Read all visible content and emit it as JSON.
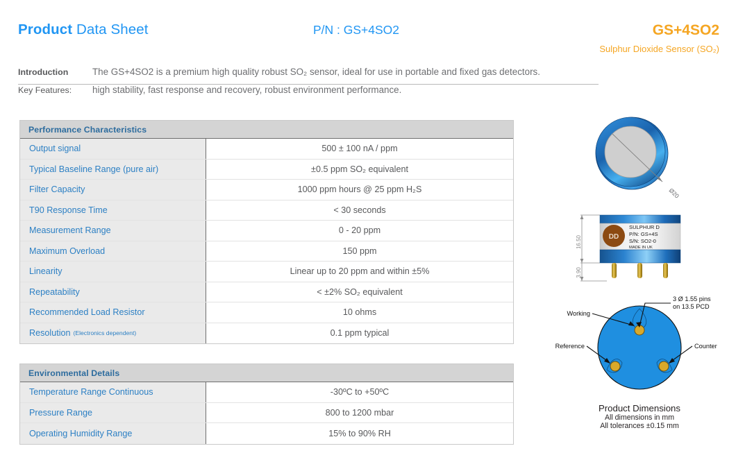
{
  "header": {
    "title_bold": "Product",
    "title_rest": " Data Sheet",
    "part_number": "P/N : GS+4SO2",
    "product_code": "GS+4SO2",
    "product_subtitle": "Sulphur Dioxide Sensor (SO₂)",
    "accent_blue": "#2196f3",
    "accent_orange": "#f5a623"
  },
  "intro": {
    "introduction_label": "Introduction",
    "introduction_text": "The GS+4SO2 is a premium high quality robust SO₂ sensor, ideal for use in portable and fixed gas detectors.",
    "key_features_label": "Key Features:",
    "key_features_text": "high stability, fast response and recovery, robust environment performance."
  },
  "performance_table": {
    "header": "Performance Characteristics",
    "rows": [
      {
        "label": "Output signal",
        "note": "",
        "value": "500 ± 100 nA / ppm"
      },
      {
        "label": "Typical Baseline Range (pure air)",
        "note": "",
        "value": "±0.5 ppm SO₂ equivalent"
      },
      {
        "label": "Filter Capacity",
        "note": "",
        "value": "1000 ppm hours @ 25 ppm H₂S"
      },
      {
        "label": "T90 Response Time",
        "note": "",
        "value": "< 30 seconds"
      },
      {
        "label": "Measurement Range",
        "note": "",
        "value": "0 - 20 ppm"
      },
      {
        "label": "Maximum Overload",
        "note": "",
        "value": "150 ppm"
      },
      {
        "label": "Linearity",
        "note": "",
        "value": "Linear up to 20 ppm and within ±5%"
      },
      {
        "label": "Repeatability",
        "note": "",
        "value": "< ±2% SO₂ equivalent"
      },
      {
        "label": "Recommended Load Resistor",
        "note": "",
        "value": "10 ohms"
      },
      {
        "label": "Resolution",
        "note": "(Electronics dependent)",
        "value": "0.1 ppm typical"
      }
    ]
  },
  "environmental_table": {
    "header": "Environmental Details",
    "rows": [
      {
        "label": "Temperature Range Continuous",
        "note": "",
        "value": "-30ºC to +50ºC"
      },
      {
        "label": "Pressure Range",
        "note": "",
        "value": "800 to 1200 mbar"
      },
      {
        "label": "Operating Humidity Range",
        "note": "",
        "value": "15% to 90% RH"
      }
    ]
  },
  "diagrams": {
    "top_view": {
      "diameter_label": "Ø20"
    },
    "side_view": {
      "height_dim": "16.50",
      "pin_dim": "3.90",
      "label_logo": "DD",
      "label_lines": [
        "SULPHUR D",
        "P/N: GS+4S",
        "S/N:  SO2-0",
        "MADE IN UK"
      ]
    },
    "bottom_view": {
      "pin_callout_line1": "3 Ø 1.55 pins",
      "pin_callout_line2": "on 13.5 PCD",
      "working_label": "Working",
      "reference_label": "Reference",
      "counter_label": "Counter"
    },
    "caption": {
      "title": "Product Dimensions",
      "line1": "All dimensions in mm",
      "line2": "All tolerances ±0.15 mm"
    }
  }
}
